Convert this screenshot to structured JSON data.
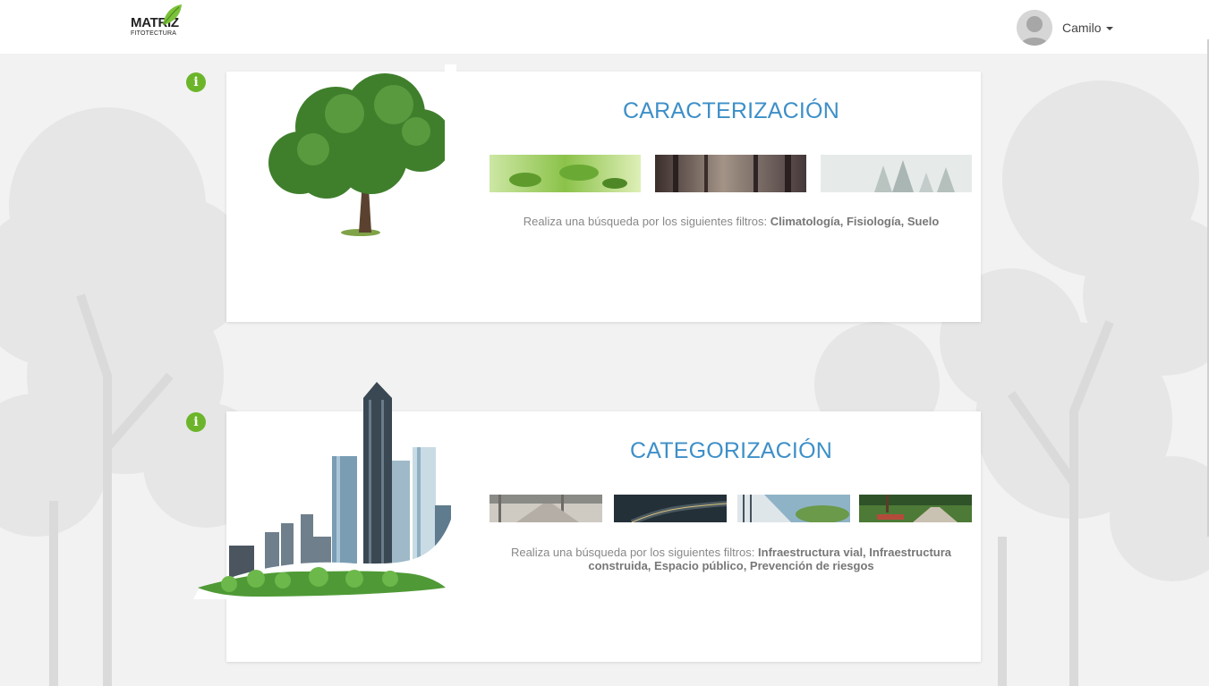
{
  "header": {
    "logo_text": "MATRIZ",
    "logo_subtext": "FITOTECTURA",
    "user_name": "Camilo"
  },
  "sections": [
    {
      "title": "CARACTERIZACIÓN",
      "description_prefix": "Realiza una búsqueda por los siguientes filtros: ",
      "filters": "Climatología, Fisiología, Suelo",
      "info_icon": "info-icon"
    },
    {
      "title": "CATEGORIZACIÓN",
      "description_prefix": "Realiza una búsqueda por los siguientes filtros: ",
      "filters": "Infraestructura vial, Infraestructura construida, Espacio público, Prevención de riesgos",
      "info_icon": "info-icon"
    }
  ],
  "colors": {
    "accent": "#3d8fc8",
    "info_green": "#6cb52a",
    "background": "#f2f2f2"
  }
}
